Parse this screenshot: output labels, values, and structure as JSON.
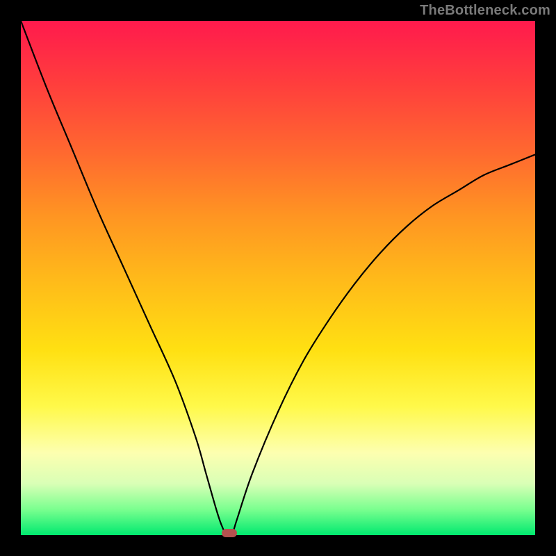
{
  "watermark": "TheBottleneck.com",
  "colors": {
    "frame": "#000000",
    "curve": "#000000",
    "marker": "#b4524f"
  },
  "chart_data": {
    "type": "line",
    "title": "",
    "xlabel": "",
    "ylabel": "",
    "xlim": [
      0,
      100
    ],
    "ylim": [
      0,
      100
    ],
    "grid": false,
    "series": [
      {
        "name": "bottleneck-curve",
        "x": [
          0,
          5,
          10,
          15,
          20,
          25,
          30,
          34,
          36,
          38,
          39,
          40,
          41,
          42,
          45,
          50,
          55,
          60,
          65,
          70,
          75,
          80,
          85,
          90,
          95,
          100
        ],
        "values": [
          100,
          87,
          75,
          63,
          52,
          41,
          30,
          19,
          12,
          5,
          2,
          0,
          0,
          3,
          12,
          24,
          34,
          42,
          49,
          55,
          60,
          64,
          67,
          70,
          72,
          74
        ]
      }
    ],
    "marker": {
      "x": 40.5,
      "y": 0
    },
    "background_gradient": [
      "#ff1a4d",
      "#ffe012",
      "#00e96f"
    ]
  }
}
